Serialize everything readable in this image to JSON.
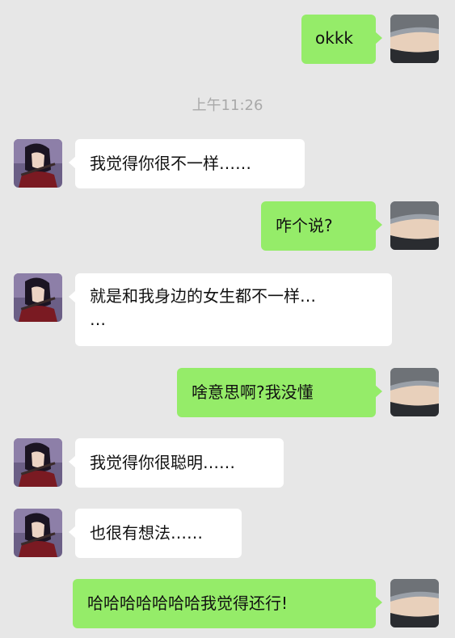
{
  "colors": {
    "background": "#e7e7e7",
    "incoming_bubble": "#ffffff",
    "outgoing_bubble": "#95ec69",
    "timestamp_text": "#a9a9a9"
  },
  "timestamp": "上午11:26",
  "messages": [
    {
      "direction": "outgoing",
      "text": "okkk"
    },
    {
      "direction": "incoming",
      "text": "我觉得你很不一样……"
    },
    {
      "direction": "outgoing",
      "text": "咋个说?"
    },
    {
      "direction": "incoming",
      "line1": "就是和我身边的女生都不一样…",
      "line2": "…"
    },
    {
      "direction": "outgoing",
      "text": "啥意思啊?我没懂"
    },
    {
      "direction": "incoming",
      "text": "我觉得你很聪明……"
    },
    {
      "direction": "incoming",
      "text": "也很有想法……"
    },
    {
      "direction": "outgoing",
      "text": "哈哈哈哈哈哈哈我觉得还行!"
    }
  ],
  "avatars": {
    "incoming": "anime-character-avatar",
    "outgoing": "torso-photo-avatar"
  }
}
